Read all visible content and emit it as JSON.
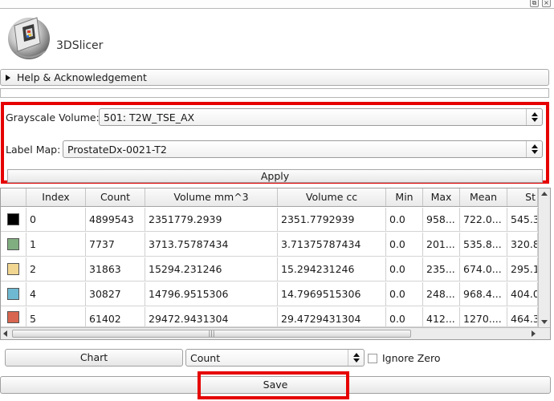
{
  "app": {
    "logo_text": "3DSlicer"
  },
  "help_section": {
    "label": "Help & Acknowledgement"
  },
  "form": {
    "grayscale_label": "Grayscale Volume:",
    "grayscale_value": "501: T2W_TSE_AX",
    "labelmap_label": "Label Map:",
    "labelmap_value": "ProstateDx-0021-T2",
    "apply_label": "Apply"
  },
  "table": {
    "headers": [
      "",
      "Index",
      "Count",
      "Volume mm^3",
      "Volume cc",
      "Min",
      "Max",
      "Mean",
      "St"
    ],
    "rows": [
      {
        "color": "#000000",
        "index": "0",
        "count": "4899543",
        "volume_mm3": "2351779.2939",
        "volume_cc": "2351.7792939",
        "min": "0.0",
        "max": "958...",
        "mean": "722.0...",
        "std": "545.3"
      },
      {
        "color": "#80ae80",
        "index": "1",
        "count": "7737",
        "volume_mm3": "3713.75787434",
        "volume_cc": "3.71375787434",
        "min": "0.0",
        "max": "201...",
        "mean": "535.8...",
        "std": "320.8"
      },
      {
        "color": "#f1d691",
        "index": "2",
        "count": "31863",
        "volume_mm3": "15294.231246",
        "volume_cc": "15.294231246",
        "min": "0.0",
        "max": "235...",
        "mean": "674.0...",
        "std": "295.1"
      },
      {
        "color": "#6fb8d2",
        "index": "4",
        "count": "30827",
        "volume_mm3": "14796.9515306",
        "volume_cc": "14.7969515306",
        "min": "0.0",
        "max": "248...",
        "mean": "968.4...",
        "std": "404.0"
      },
      {
        "color": "#d8654f",
        "index": "5",
        "count": "61402",
        "volume_mm3": "29472.9431304",
        "volume_cc": "29.4729431304",
        "min": "0.0",
        "max": "412...",
        "mean": "1270....",
        "std": "464.3"
      }
    ]
  },
  "controls": {
    "chart_label": "Chart",
    "chart_select_value": "Count",
    "ignore_zero_label": "Ignore Zero",
    "save_label": "Save"
  }
}
